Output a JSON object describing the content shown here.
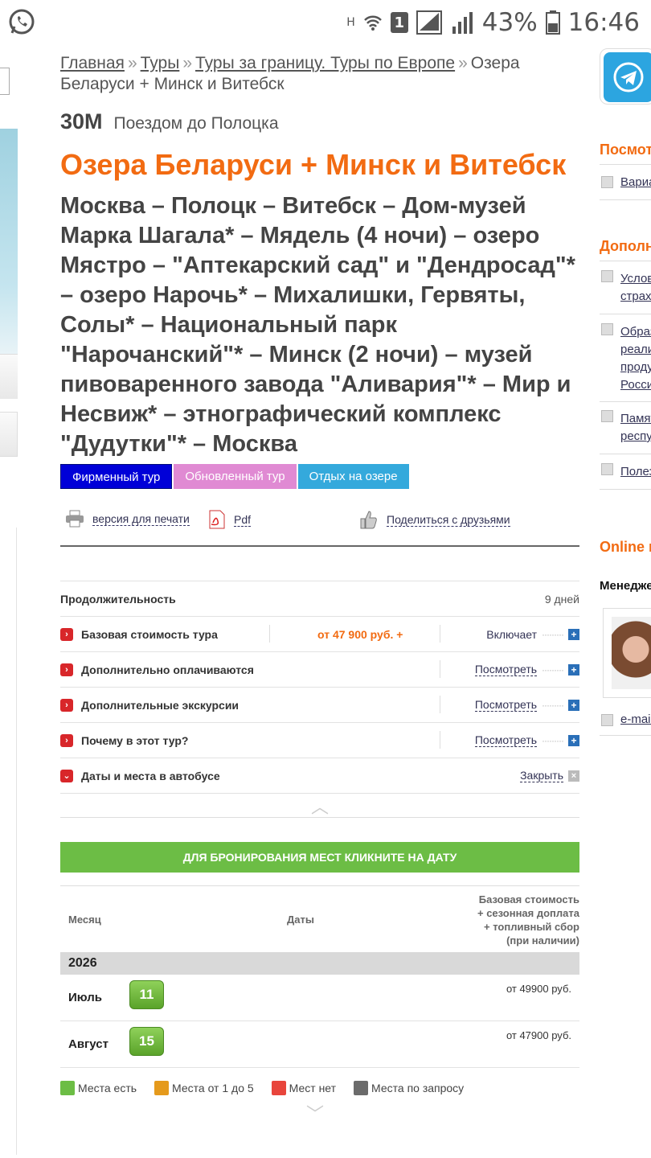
{
  "status_bar": {
    "net_label": "H",
    "sim": "1",
    "battery": "43%",
    "time": "16:46"
  },
  "breadcrumb": {
    "home": "Главная",
    "tours": "Туры",
    "abroad": "Туры за границу. Туры по Европе",
    "current": "Озера Беларуси + Минск и Витебск",
    "separator": "»"
  },
  "tour": {
    "code": "30М",
    "subtitle": "Поездом до Полоцка",
    "title": "Озера Беларуси + Минск и Витебск",
    "route": "Москва – Полоцк – Витебск – Дом-музей Марка Шагала* – Мядель (4 ночи) – озеро Мястро – \"Аптекарский сад\" и \"Дендросад\"* – озеро Нарочь* – Михалишки, Гервяты, Солы* – Национальный парк \"Нарочанский\"* – Минск (2 ночи) – музей пивоваренного завода \"Аливария\"* – Мир и Несвиж* – этнографический комплекс \"Дудутки\"* – Москва",
    "tags": [
      "Фирменный тур",
      "Обновленный тур",
      "Отдых на озере"
    ]
  },
  "tools": {
    "print": "версия для печати",
    "pdf": "Pdf",
    "share": "Поделиться с друзьями"
  },
  "details": {
    "duration_label": "Продолжительность",
    "duration_value": "9 дней",
    "rows": [
      {
        "name": "Базовая стоимость тура",
        "price": "от 47 900 руб. +",
        "action": "Включает"
      },
      {
        "name": "Дополнительно оплачиваются",
        "action": "Посмотреть"
      },
      {
        "name": "Дополнительные экскурсии",
        "action": "Посмотреть"
      },
      {
        "name": "Почему в этот тур?",
        "action": "Посмотреть"
      },
      {
        "name": "Даты и места в автобусе",
        "action": "Закрыть"
      }
    ]
  },
  "booking": {
    "bar": "ДЛЯ БРОНИРОВАНИЯ МЕСТ КЛИКНИТЕ НА ДАТУ",
    "col_month": "Месяц",
    "col_dates": "Даты",
    "col_price_lines": [
      "Базовая стоимость",
      "+ сезонная доплата",
      "+ топливный сбор",
      "(при наличии)"
    ],
    "year": "2026",
    "months": [
      {
        "name": "Июль",
        "date": "11",
        "price": "от 49900 руб."
      },
      {
        "name": "Август",
        "date": "15",
        "price": "от 47900 руб."
      }
    ],
    "legend": [
      {
        "label": "Места есть",
        "color": "#6cbd45"
      },
      {
        "label": "Места от 1 до 5",
        "color": "#e59a1c"
      },
      {
        "label": "Мест нет",
        "color": "#e8453c"
      },
      {
        "label": "Места по запросу",
        "color": "#6b6b6b"
      }
    ]
  },
  "right": {
    "h1": "Посмотрите",
    "link1": "Варианты",
    "h2": "Дополнительно",
    "links2": [
      "Условия",
      "страхования",
      "Образцы",
      "реализации",
      "продукции",
      "России",
      "Памятки",
      "республике",
      "Полезное"
    ],
    "h3": "Online менеджер",
    "manager": "Менеджер",
    "email": "e-mail"
  }
}
